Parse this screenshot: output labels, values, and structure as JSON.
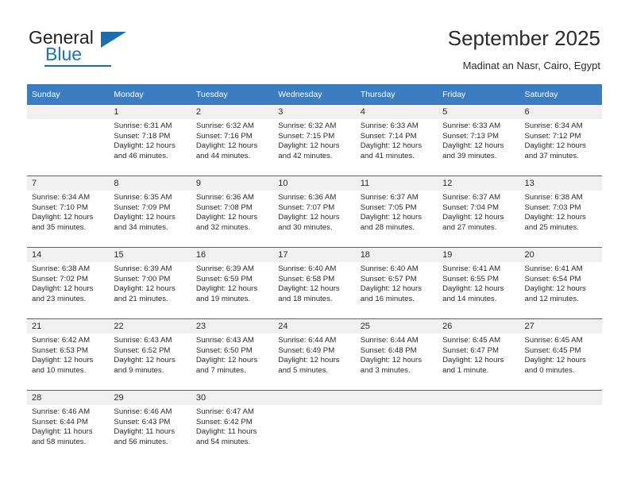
{
  "brand": {
    "name_part1": "General",
    "name_part2": "Blue",
    "logo_icon": "triangle-flag-icon"
  },
  "header": {
    "title": "September 2025",
    "location": "Madinat an Nasr, Cairo, Egypt"
  },
  "calendar": {
    "weekday_headers": [
      "Sunday",
      "Monday",
      "Tuesday",
      "Wednesday",
      "Thursday",
      "Friday",
      "Saturday"
    ],
    "accent_color": "#3b7dc0",
    "row_line_color": "#2d6fb3",
    "daynum_band_color": "#f0f0f0",
    "weeks": [
      [
        {
          "day": "",
          "sunrise": "",
          "sunset": "",
          "daylight_line1": "",
          "daylight_line2": ""
        },
        {
          "day": "1",
          "sunrise": "Sunrise: 6:31 AM",
          "sunset": "Sunset: 7:18 PM",
          "daylight_line1": "Daylight: 12 hours",
          "daylight_line2": "and 46 minutes."
        },
        {
          "day": "2",
          "sunrise": "Sunrise: 6:32 AM",
          "sunset": "Sunset: 7:16 PM",
          "daylight_line1": "Daylight: 12 hours",
          "daylight_line2": "and 44 minutes."
        },
        {
          "day": "3",
          "sunrise": "Sunrise: 6:32 AM",
          "sunset": "Sunset: 7:15 PM",
          "daylight_line1": "Daylight: 12 hours",
          "daylight_line2": "and 42 minutes."
        },
        {
          "day": "4",
          "sunrise": "Sunrise: 6:33 AM",
          "sunset": "Sunset: 7:14 PM",
          "daylight_line1": "Daylight: 12 hours",
          "daylight_line2": "and 41 minutes."
        },
        {
          "day": "5",
          "sunrise": "Sunrise: 6:33 AM",
          "sunset": "Sunset: 7:13 PM",
          "daylight_line1": "Daylight: 12 hours",
          "daylight_line2": "and 39 minutes."
        },
        {
          "day": "6",
          "sunrise": "Sunrise: 6:34 AM",
          "sunset": "Sunset: 7:12 PM",
          "daylight_line1": "Daylight: 12 hours",
          "daylight_line2": "and 37 minutes."
        }
      ],
      [
        {
          "day": "7",
          "sunrise": "Sunrise: 6:34 AM",
          "sunset": "Sunset: 7:10 PM",
          "daylight_line1": "Daylight: 12 hours",
          "daylight_line2": "and 35 minutes."
        },
        {
          "day": "8",
          "sunrise": "Sunrise: 6:35 AM",
          "sunset": "Sunset: 7:09 PM",
          "daylight_line1": "Daylight: 12 hours",
          "daylight_line2": "and 34 minutes."
        },
        {
          "day": "9",
          "sunrise": "Sunrise: 6:36 AM",
          "sunset": "Sunset: 7:08 PM",
          "daylight_line1": "Daylight: 12 hours",
          "daylight_line2": "and 32 minutes."
        },
        {
          "day": "10",
          "sunrise": "Sunrise: 6:36 AM",
          "sunset": "Sunset: 7:07 PM",
          "daylight_line1": "Daylight: 12 hours",
          "daylight_line2": "and 30 minutes."
        },
        {
          "day": "11",
          "sunrise": "Sunrise: 6:37 AM",
          "sunset": "Sunset: 7:05 PM",
          "daylight_line1": "Daylight: 12 hours",
          "daylight_line2": "and 28 minutes."
        },
        {
          "day": "12",
          "sunrise": "Sunrise: 6:37 AM",
          "sunset": "Sunset: 7:04 PM",
          "daylight_line1": "Daylight: 12 hours",
          "daylight_line2": "and 27 minutes."
        },
        {
          "day": "13",
          "sunrise": "Sunrise: 6:38 AM",
          "sunset": "Sunset: 7:03 PM",
          "daylight_line1": "Daylight: 12 hours",
          "daylight_line2": "and 25 minutes."
        }
      ],
      [
        {
          "day": "14",
          "sunrise": "Sunrise: 6:38 AM",
          "sunset": "Sunset: 7:02 PM",
          "daylight_line1": "Daylight: 12 hours",
          "daylight_line2": "and 23 minutes."
        },
        {
          "day": "15",
          "sunrise": "Sunrise: 6:39 AM",
          "sunset": "Sunset: 7:00 PM",
          "daylight_line1": "Daylight: 12 hours",
          "daylight_line2": "and 21 minutes."
        },
        {
          "day": "16",
          "sunrise": "Sunrise: 6:39 AM",
          "sunset": "Sunset: 6:59 PM",
          "daylight_line1": "Daylight: 12 hours",
          "daylight_line2": "and 19 minutes."
        },
        {
          "day": "17",
          "sunrise": "Sunrise: 6:40 AM",
          "sunset": "Sunset: 6:58 PM",
          "daylight_line1": "Daylight: 12 hours",
          "daylight_line2": "and 18 minutes."
        },
        {
          "day": "18",
          "sunrise": "Sunrise: 6:40 AM",
          "sunset": "Sunset: 6:57 PM",
          "daylight_line1": "Daylight: 12 hours",
          "daylight_line2": "and 16 minutes."
        },
        {
          "day": "19",
          "sunrise": "Sunrise: 6:41 AM",
          "sunset": "Sunset: 6:55 PM",
          "daylight_line1": "Daylight: 12 hours",
          "daylight_line2": "and 14 minutes."
        },
        {
          "day": "20",
          "sunrise": "Sunrise: 6:41 AM",
          "sunset": "Sunset: 6:54 PM",
          "daylight_line1": "Daylight: 12 hours",
          "daylight_line2": "and 12 minutes."
        }
      ],
      [
        {
          "day": "21",
          "sunrise": "Sunrise: 6:42 AM",
          "sunset": "Sunset: 6:53 PM",
          "daylight_line1": "Daylight: 12 hours",
          "daylight_line2": "and 10 minutes."
        },
        {
          "day": "22",
          "sunrise": "Sunrise: 6:43 AM",
          "sunset": "Sunset: 6:52 PM",
          "daylight_line1": "Daylight: 12 hours",
          "daylight_line2": "and 9 minutes."
        },
        {
          "day": "23",
          "sunrise": "Sunrise: 6:43 AM",
          "sunset": "Sunset: 6:50 PM",
          "daylight_line1": "Daylight: 12 hours",
          "daylight_line2": "and 7 minutes."
        },
        {
          "day": "24",
          "sunrise": "Sunrise: 6:44 AM",
          "sunset": "Sunset: 6:49 PM",
          "daylight_line1": "Daylight: 12 hours",
          "daylight_line2": "and 5 minutes."
        },
        {
          "day": "25",
          "sunrise": "Sunrise: 6:44 AM",
          "sunset": "Sunset: 6:48 PM",
          "daylight_line1": "Daylight: 12 hours",
          "daylight_line2": "and 3 minutes."
        },
        {
          "day": "26",
          "sunrise": "Sunrise: 6:45 AM",
          "sunset": "Sunset: 6:47 PM",
          "daylight_line1": "Daylight: 12 hours",
          "daylight_line2": "and 1 minute."
        },
        {
          "day": "27",
          "sunrise": "Sunrise: 6:45 AM",
          "sunset": "Sunset: 6:45 PM",
          "daylight_line1": "Daylight: 12 hours",
          "daylight_line2": "and 0 minutes."
        }
      ],
      [
        {
          "day": "28",
          "sunrise": "Sunrise: 6:46 AM",
          "sunset": "Sunset: 6:44 PM",
          "daylight_line1": "Daylight: 11 hours",
          "daylight_line2": "and 58 minutes."
        },
        {
          "day": "29",
          "sunrise": "Sunrise: 6:46 AM",
          "sunset": "Sunset: 6:43 PM",
          "daylight_line1": "Daylight: 11 hours",
          "daylight_line2": "and 56 minutes."
        },
        {
          "day": "30",
          "sunrise": "Sunrise: 6:47 AM",
          "sunset": "Sunset: 6:42 PM",
          "daylight_line1": "Daylight: 11 hours",
          "daylight_line2": "and 54 minutes."
        },
        {
          "day": "",
          "sunrise": "",
          "sunset": "",
          "daylight_line1": "",
          "daylight_line2": ""
        },
        {
          "day": "",
          "sunrise": "",
          "sunset": "",
          "daylight_line1": "",
          "daylight_line2": ""
        },
        {
          "day": "",
          "sunrise": "",
          "sunset": "",
          "daylight_line1": "",
          "daylight_line2": ""
        },
        {
          "day": "",
          "sunrise": "",
          "sunset": "",
          "daylight_line1": "",
          "daylight_line2": ""
        }
      ]
    ]
  }
}
